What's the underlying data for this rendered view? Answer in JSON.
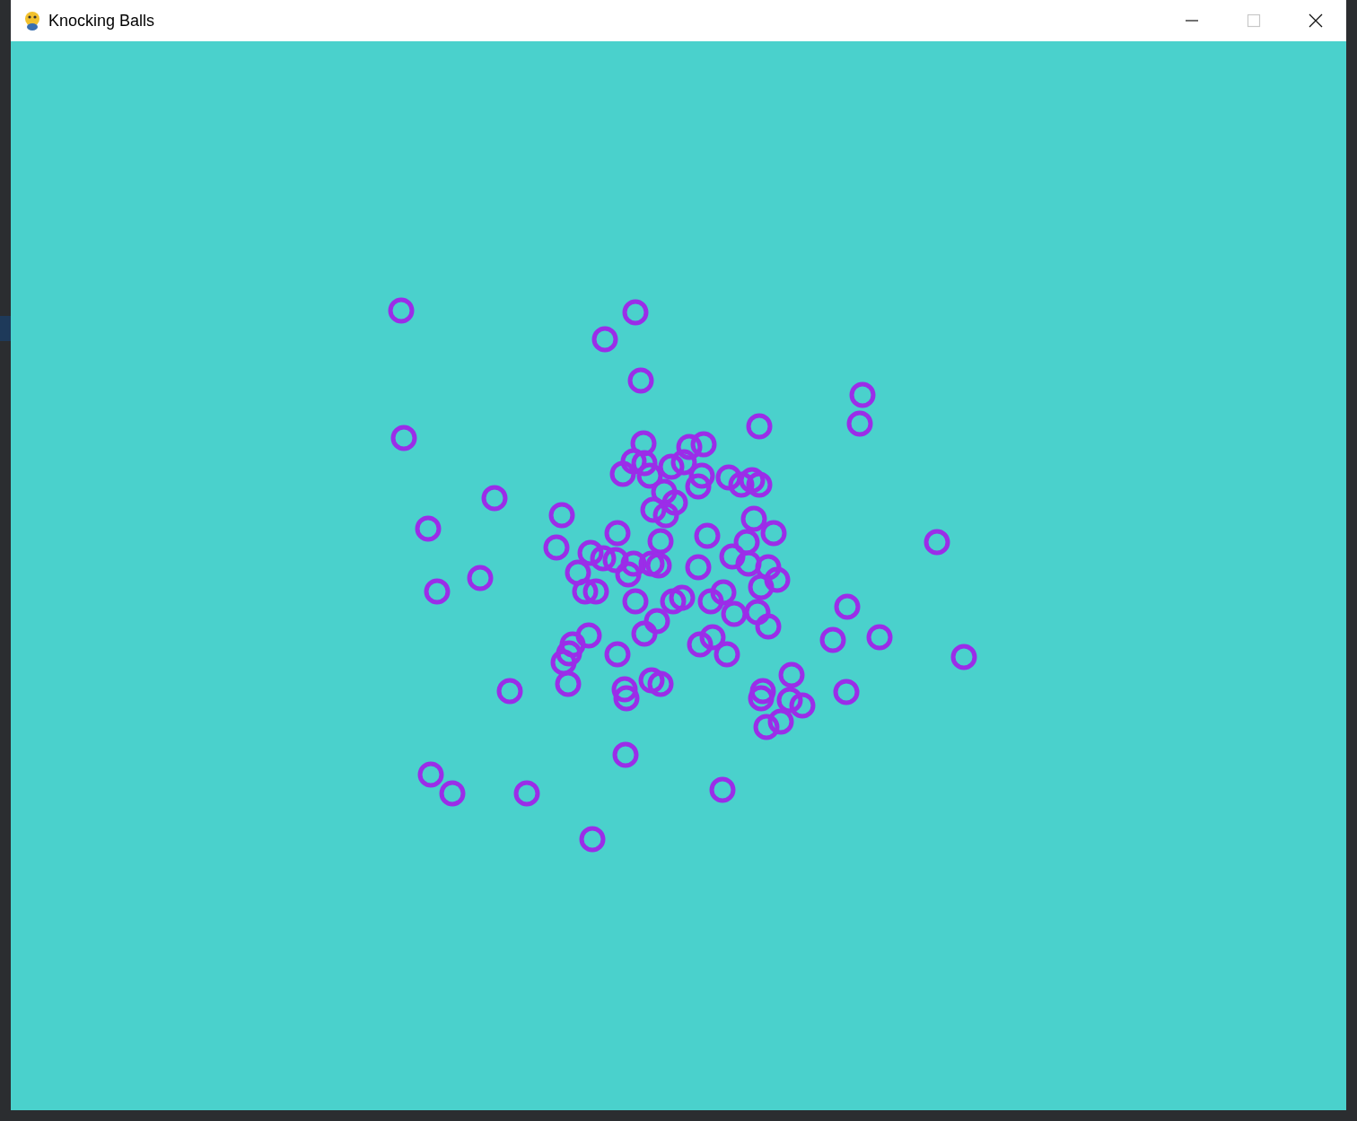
{
  "window": {
    "title": "Knocking Balls",
    "controls": [
      {
        "kind": "minimize",
        "disabled": false
      },
      {
        "kind": "maximize",
        "disabled": true
      },
      {
        "kind": "close",
        "disabled": false
      }
    ]
  }
}
